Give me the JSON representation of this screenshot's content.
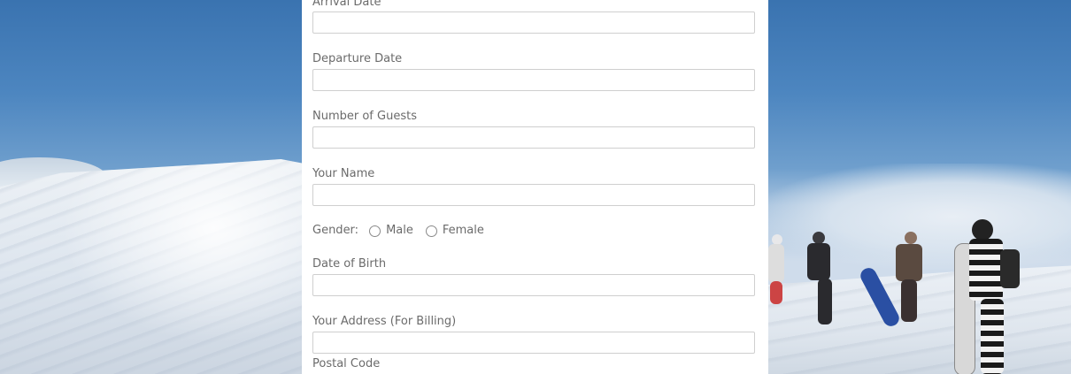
{
  "form": {
    "arrival_date": {
      "label": "Arrival Date",
      "value": "",
      "placeholder": ""
    },
    "departure_date": {
      "label": "Departure Date",
      "value": "",
      "placeholder": ""
    },
    "number_of_guests": {
      "label": "Number of Guests",
      "value": "",
      "placeholder": ""
    },
    "your_name": {
      "label": "Your Name",
      "value": "",
      "placeholder": ""
    },
    "gender": {
      "label": "Gender:",
      "options": [
        "Male",
        "Female"
      ],
      "selected": null
    },
    "date_of_birth": {
      "label": "Date of Birth",
      "value": "",
      "placeholder": ""
    },
    "address": {
      "label": "Your Address (For Billing)",
      "value": "",
      "placeholder": ""
    },
    "postal_code": {
      "label": "Postal Code"
    }
  },
  "colors": {
    "panel_background": "#ffffff",
    "label_text": "#6b6b6b",
    "input_border": "#cfcfcf",
    "sky": "#3a73b0"
  }
}
